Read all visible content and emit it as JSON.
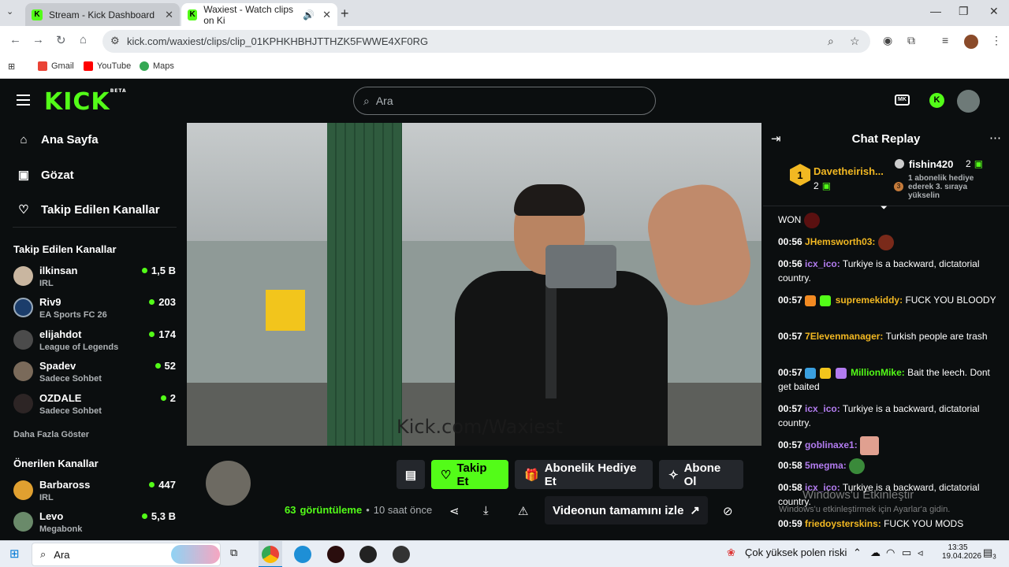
{
  "browser": {
    "tabs": [
      {
        "title": "Stream - Kick Dashboard",
        "active": false
      },
      {
        "title": "Waxiest - Watch clips on Ki",
        "active": true
      }
    ],
    "url": "kick.com/waxiest/clips/clip_01KPHKHBHJTTHZK5FWWE4XF0RG",
    "bookmarks": [
      "Gmail",
      "YouTube",
      "Maps"
    ]
  },
  "header": {
    "logo": "KICK",
    "logo_sup": "BETA",
    "search_placeholder": "Ara"
  },
  "sidebar": {
    "nav": [
      {
        "label": "Ana Sayfa",
        "icon": "home-icon"
      },
      {
        "label": "Gözat",
        "icon": "browse-icon"
      },
      {
        "label": "Takip Edilen Kanallar",
        "icon": "heart-icon"
      }
    ],
    "followed_heading": "Takip Edilen Kanallar",
    "followed": [
      {
        "name": "ilkinsan",
        "category": "IRL",
        "viewers": "1,5 B",
        "color": "#c9b6a0"
      },
      {
        "name": "Riv9",
        "category": "EA Sports FC 26",
        "viewers": "203",
        "color": "#1b3d6b"
      },
      {
        "name": "elijahdot",
        "category": "League of Legends",
        "viewers": "174",
        "color": "#4b4b4b"
      },
      {
        "name": "Spadev",
        "category": "Sadece Sohbet",
        "viewers": "52",
        "color": "#7a6a5a"
      },
      {
        "name": "OZDALE",
        "category": "Sadece Sohbet",
        "viewers": "2",
        "color": "#2d2525"
      }
    ],
    "show_more": "Daha Fazla Göster",
    "recommended_heading": "Önerilen Kanallar",
    "recommended": [
      {
        "name": "Barbaross",
        "category": "IRL",
        "viewers": "447",
        "color": "#e0a030"
      },
      {
        "name": "Levo",
        "category": "Megabonk",
        "viewers": "5,3 B",
        "color": "#6a8a6a"
      }
    ]
  },
  "video": {
    "watermark": "Kick.com/Waxiest"
  },
  "actions": {
    "follow": "Takip Et",
    "gift_sub": "Abonelik Hediye Et",
    "subscribe": "Abone Ol",
    "views_count": "63",
    "views_word": "görüntüleme",
    "time_ago": "10 saat önce",
    "watch_full": "Videonun tamamını izle"
  },
  "chat": {
    "title": "Chat Replay",
    "pinned": {
      "rank": "1",
      "top_user": "Davetheirish...",
      "top_user_count": "2",
      "second_user": "fishin420",
      "second_user_count": "2",
      "rank3": "3",
      "hint": "1 abonelik hediye ederek 3. sıraya yükselin"
    },
    "messages": [
      {
        "ts": "",
        "user": "",
        "user_color": "#ffffff",
        "text": "WON"
      },
      {
        "ts": "00:56",
        "user": "JHemsworth03:",
        "user_color": "#f2b822",
        "text": ""
      },
      {
        "ts": "00:56",
        "user": "icx_ico:",
        "user_color": "#b37cf0",
        "text": "Turkiye is a backward, dictatorial country."
      },
      {
        "ts": "00:57",
        "user": "supremekiddy:",
        "user_color": "#f2b822",
        "text": "FUCK YOU BLOODY"
      },
      {
        "ts": "00:57",
        "user": "7Elevenmanager:",
        "user_color": "#f2b822",
        "text": "Turkish people are trash"
      },
      {
        "ts": "00:57",
        "user": "MillionMike:",
        "user_color": "#53fc18",
        "text": "Bait the leech. Dont get baited"
      },
      {
        "ts": "00:57",
        "user": "icx_ico:",
        "user_color": "#b37cf0",
        "text": "Turkiye is a backward, dictatorial country."
      },
      {
        "ts": "00:57",
        "user": "goblinaxe1:",
        "user_color": "#b37cf0",
        "text": ""
      },
      {
        "ts": "00:58",
        "user": "5megma:",
        "user_color": "#b37cf0",
        "text": ""
      },
      {
        "ts": "00:58",
        "user": "icx_ico:",
        "user_color": "#b37cf0",
        "text": "Turkiye is a backward, dictatorial country."
      },
      {
        "ts": "00:59",
        "user": "friedoysterskins:",
        "user_color": "#f2b822",
        "text": "FUCK YOU MODS"
      }
    ],
    "activation_title": "Windows'u Etkinleştir",
    "activation_hint": "Windows'u etkinleştirmek için Ayarlar'a gidin."
  },
  "taskbar": {
    "search": "Ara",
    "weather": "Çok yüksek polen riski",
    "time": "13:35",
    "date": "19.04.2026",
    "notifications": "3"
  }
}
